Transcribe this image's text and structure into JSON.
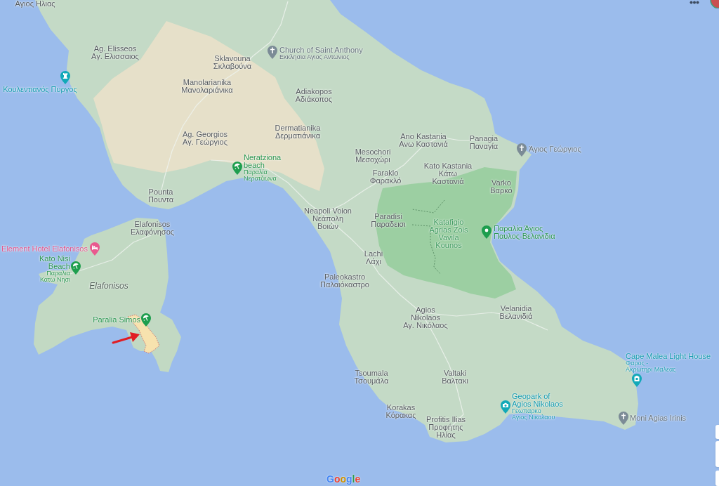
{
  "map": {
    "place_labels": [
      {
        "kind": "town",
        "local_name": [
          "Αγιος Ηλιας"
        ]
      },
      {
        "kind": "town",
        "name": [
          "Ag. Elisseos"
        ],
        "local_name": [
          "Αγ. Ελισσαιος"
        ]
      },
      {
        "kind": "town",
        "name": [
          "Sklavouna"
        ],
        "local_name": [
          "Σκλαβούνα"
        ]
      },
      {
        "kind": "town",
        "name": [
          "Manolarianika"
        ],
        "local_name": [
          "Μανολαριάνικα"
        ]
      },
      {
        "kind": "town",
        "name": [
          "Adiakopos"
        ],
        "local_name": [
          "Αδιάκοπος"
        ]
      },
      {
        "kind": "town",
        "name": [
          "Dermatianika"
        ],
        "local_name": [
          "Δερματιάνικα"
        ]
      },
      {
        "kind": "town",
        "name": [
          "Ag. Georgios"
        ],
        "local_name": [
          "Αγ. Γεώργιος"
        ]
      },
      {
        "kind": "town",
        "name": [
          "Ano Kastania"
        ],
        "local_name": [
          "Ανω Καστανιά"
        ]
      },
      {
        "kind": "town",
        "name": [
          "Panagia"
        ],
        "local_name": [
          "Παναγία"
        ]
      },
      {
        "kind": "town",
        "name": [
          "Mesochori"
        ],
        "local_name": [
          "Μεσοχώρι"
        ]
      },
      {
        "kind": "town",
        "name": [
          "Faraklo"
        ],
        "local_name": [
          "Φαρακλό"
        ]
      },
      {
        "kind": "town",
        "name": [
          "Kato Kastania"
        ],
        "local_name": [
          "Κάτω",
          "Καστανιά"
        ]
      },
      {
        "kind": "town",
        "name": [
          "Varko"
        ],
        "local_name": [
          "Βαρκό"
        ]
      },
      {
        "kind": "town",
        "name": [
          "Pounta"
        ],
        "local_name": [
          "Πουντα"
        ]
      },
      {
        "kind": "town",
        "name": [
          "Neapoli Voion"
        ],
        "local_name": [
          "Νεάπολη",
          "Βοιών"
        ]
      },
      {
        "kind": "town",
        "name": [
          "Paradisi"
        ],
        "local_name": [
          "Παραδεισι"
        ]
      },
      {
        "kind": "town",
        "name": [
          "Elafonisos"
        ],
        "local_name": [
          "Ελαφόνησος"
        ]
      },
      {
        "kind": "town",
        "name": [
          "Lachi"
        ],
        "local_name": [
          "Λάχι"
        ]
      },
      {
        "kind": "island",
        "name": [
          "Elafonisos"
        ]
      },
      {
        "kind": "town",
        "name": [
          "Paleokastro"
        ],
        "local_name": [
          "Παλαιόκαστρο"
        ]
      },
      {
        "kind": "town",
        "name": [
          "Agios",
          "Nikolaos"
        ],
        "local_name": [
          "Αγ. Νικόλαος"
        ]
      },
      {
        "kind": "town",
        "name": [
          "Velanidia"
        ],
        "local_name": [
          "Βελανιδιά"
        ]
      },
      {
        "kind": "town",
        "name": [
          "Tsoumala"
        ],
        "local_name": [
          "Τσουμάλα"
        ]
      },
      {
        "kind": "town",
        "name": [
          "Valtaki"
        ],
        "local_name": [
          "Βαλτακι"
        ]
      },
      {
        "kind": "town",
        "name": [
          "Korakas"
        ],
        "local_name": [
          "Κόρακας"
        ]
      },
      {
        "kind": "town",
        "name": [
          "Profitis Ilias"
        ],
        "local_name": [
          "Προφήτης",
          "Ηλίας"
        ]
      }
    ],
    "points_of_interest": [
      {
        "kind": "church",
        "name": [
          "Church of Saint Anthony"
        ],
        "local_name": [
          "Εκκλησια Αγιος Αντωνιος"
        ]
      },
      {
        "kind": "tower",
        "name": [
          "Κουλεντιανός Πυργος"
        ]
      },
      {
        "kind": "church",
        "name": [
          "Άγιος Γεώργιος"
        ]
      },
      {
        "kind": "beach",
        "name": [
          "Neratziona",
          "beach"
        ],
        "local_name": [
          "Παραλία",
          "Νερατζιωνα"
        ]
      },
      {
        "kind": "area",
        "name": [
          "Katafigio",
          "Agrias Zois",
          "Vavila",
          "Kounos"
        ]
      },
      {
        "kind": "place",
        "name": [
          "Παραλία Άγιος",
          "Παυλος-Βελανιδια"
        ]
      },
      {
        "kind": "hotel",
        "name": [
          "Element Hotel Elafonisos"
        ]
      },
      {
        "kind": "beach",
        "name": [
          "Kato Nisi",
          "Beach"
        ],
        "local_name": [
          "Παραλια",
          "Κατω Νησι"
        ]
      },
      {
        "kind": "beach",
        "name": [
          "Paralia Simos"
        ]
      },
      {
        "kind": "lighthouse",
        "name": [
          "Cape Malea Light House"
        ],
        "local_name": [
          "Φαρος -",
          "Ακρωτηρι Μαλεας"
        ]
      },
      {
        "kind": "camera",
        "name": [
          "Geopark of",
          "Agios Nikolaos"
        ],
        "local_name": [
          "Γεωπαρκο",
          "Αγιος Νικολαου"
        ]
      },
      {
        "kind": "church",
        "name": [
          "Moni Agias Irinis"
        ]
      }
    ]
  },
  "logo": "Google"
}
